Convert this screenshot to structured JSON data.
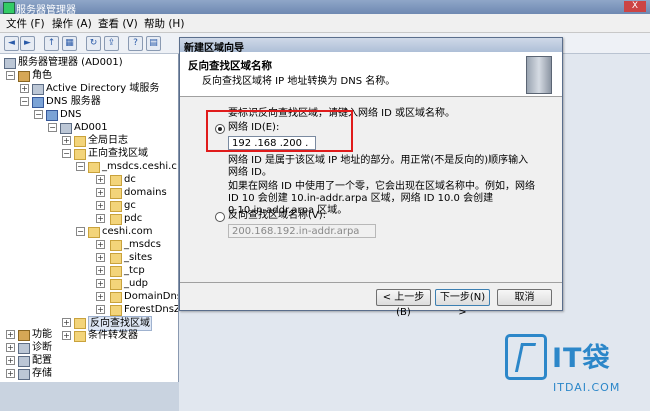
{
  "window": {
    "title": "服务器管理器",
    "close": "X"
  },
  "menu": [
    "文件 (F)",
    "操作 (A)",
    "查看 (V)",
    "帮助 (H)"
  ],
  "toolbar": {
    "back": "◄",
    "forward": "►",
    "up": "↑",
    "props": "▦",
    "refresh": "↻",
    "export": "⇪",
    "help": "?",
    "view": "▤"
  },
  "tree": {
    "root": "服务器管理器 (AD001)",
    "roles": "角色",
    "ad": "Active Directory 域服务",
    "dns_server": "DNS 服务器",
    "dns": "DNS",
    "ad001": "AD001",
    "global_logs": "全局日志",
    "forward_zones": "正向查找区域",
    "msdcs_ceshi": "_msdcs.ceshi.c",
    "dc": "dc",
    "domains": "domains",
    "gc": "gc",
    "pdc": "pdc",
    "ceshi_com": "ceshi.com",
    "msdcs": "_msdcs",
    "sites": "_sites",
    "tcp": "_tcp",
    "udp": "_udp",
    "domaindnszo": "DomainDnsZo",
    "forestdnszo": "ForestDnsZo",
    "reverse_zones": "反向查找区域",
    "conditional_forwarders": "条件转发器",
    "features": "功能",
    "diagnostics": "诊断",
    "configuration": "配置",
    "storage": "存储"
  },
  "wizard": {
    "title": "新建区域向导",
    "header_title": "反向查找区域名称",
    "header_subtitle": "反向查找区域将 IP 地址转换为 DNS 名称。",
    "instruction": "要标识反向查找区域，请键入网络 ID 或区域名称。",
    "network_id_label": "网络 ID(E):",
    "network_id_value": "192  .168  .200  .",
    "network_id_desc_1": "网络 ID 是属于该区域 IP 地址的部分。用正常(不是反向的)顺序输入",
    "network_id_desc_2": "网络 ID。",
    "example_1": "如果在网络 ID 中使用了一个零，它会出现在区域名称中。例如，网络",
    "example_2": "ID 10 会创建 10.in-addr.arpa 区域，网络 ID 10.0 会创建",
    "example_3": "0.10.in-addr.arpa 区域。",
    "zone_name_label": "反向查找区域名称(V):",
    "zone_name_value": "200.168.192.in-addr.arpa",
    "back_button": "< 上一步(B)",
    "next_button": "下一步(N) >",
    "cancel_button": "取消"
  },
  "watermark": {
    "brand": "IT袋",
    "url": "ITDAI.COM"
  },
  "colors": {
    "highlight": "#e01b1b",
    "watermark": "#2c87c9"
  }
}
